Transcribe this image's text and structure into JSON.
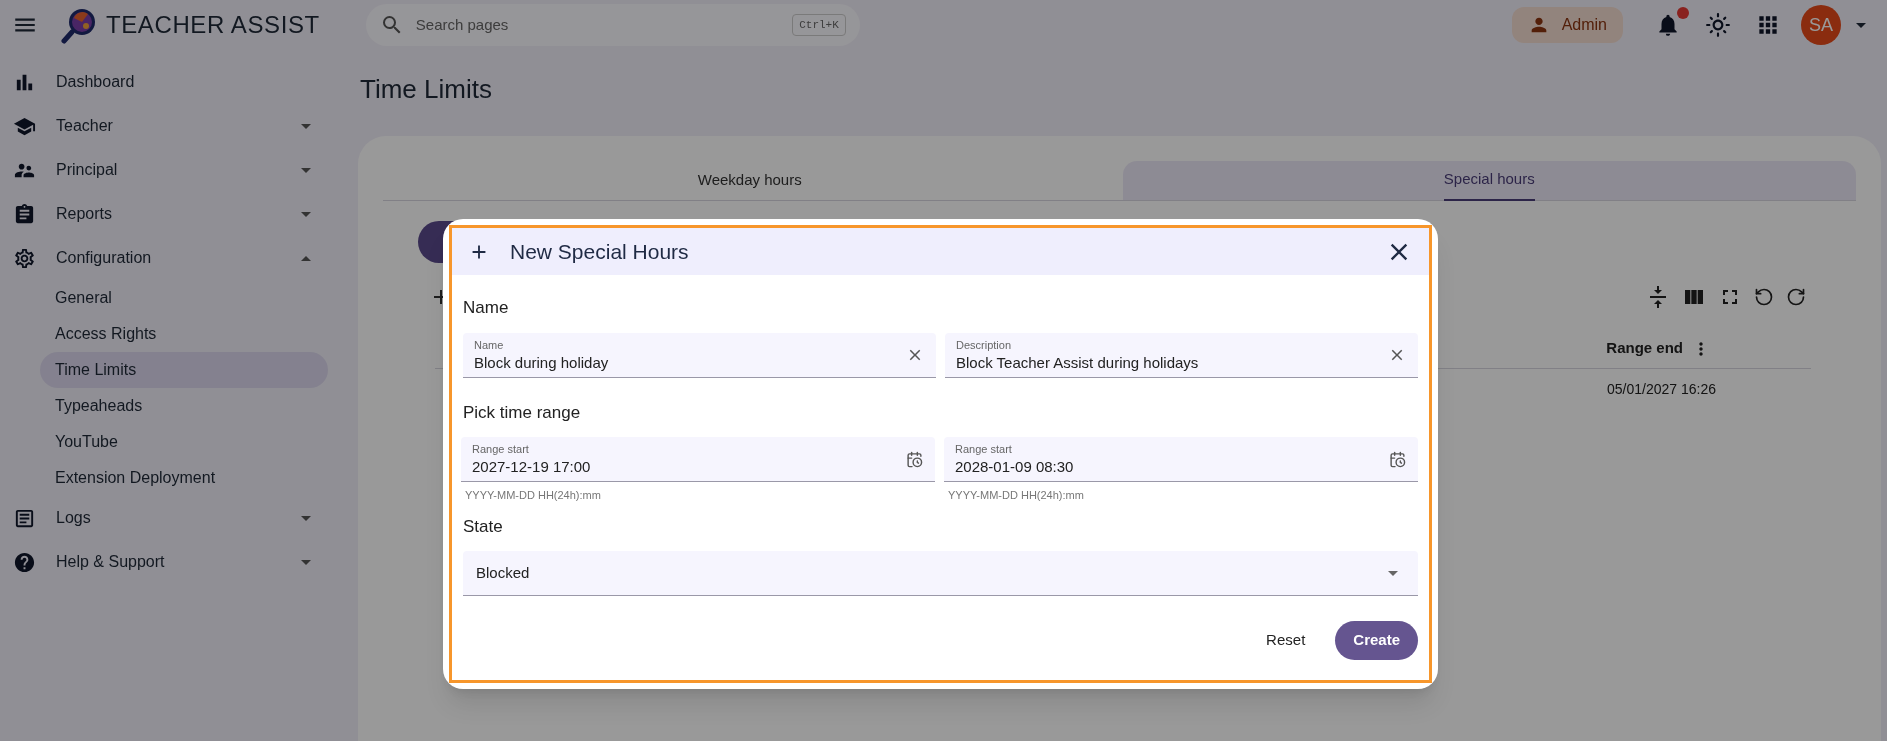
{
  "topbar": {
    "app_name": "TEACHER ASSIST",
    "search": {
      "placeholder": "Search pages",
      "shortcut": "Ctrl+K"
    },
    "role_button": "Admin",
    "notifications": {
      "unread": true
    },
    "avatar": "SA"
  },
  "sidebar": {
    "items": [
      {
        "label": "Dashboard"
      },
      {
        "label": "Teacher",
        "expanded": false
      },
      {
        "label": "Principal",
        "expanded": false
      },
      {
        "label": "Reports",
        "expanded": false
      },
      {
        "label": "Configuration",
        "expanded": true,
        "children": [
          {
            "label": "General",
            "selected": false
          },
          {
            "label": "Access Rights",
            "selected": false
          },
          {
            "label": "Time Limits",
            "selected": true
          },
          {
            "label": "Typeaheads",
            "selected": false
          },
          {
            "label": "YouTube",
            "selected": false
          },
          {
            "label": "Extension Deployment",
            "selected": false
          }
        ]
      },
      {
        "label": "Logs",
        "expanded": false
      },
      {
        "label": "Help & Support",
        "expanded": false
      }
    ]
  },
  "page": {
    "title": "Time Limits",
    "tabs": [
      {
        "label": "Weekday hours",
        "selected": false
      },
      {
        "label": "Special hours",
        "selected": true
      }
    ],
    "table": {
      "columns": [
        "Range end"
      ],
      "rows": [
        [
          "05/01/2027 16:26"
        ]
      ]
    }
  },
  "dialog": {
    "title": "New Special Hours",
    "sections": [
      {
        "heading": "Name",
        "fields": [
          {
            "kind": "text",
            "label": "Name",
            "value": "Block during holiday"
          },
          {
            "kind": "text",
            "label": "Description",
            "value": "Block Teacher Assist during holidays"
          }
        ]
      },
      {
        "heading": "Pick time range",
        "fields": [
          {
            "kind": "datetime",
            "label": "Range start",
            "value": "2027-12-19 17:00",
            "helper": "YYYY-MM-DD HH(24h):mm"
          },
          {
            "kind": "datetime",
            "label": "Range start",
            "value": "2028-01-09 08:30",
            "helper": "YYYY-MM-DD HH(24h):mm"
          }
        ]
      },
      {
        "heading": "State",
        "fields": [
          {
            "kind": "select",
            "value": "Blocked"
          }
        ]
      }
    ],
    "buttons": [
      {
        "kind": "text",
        "label": "Reset"
      },
      {
        "kind": "primary",
        "label": "Create"
      }
    ]
  }
}
